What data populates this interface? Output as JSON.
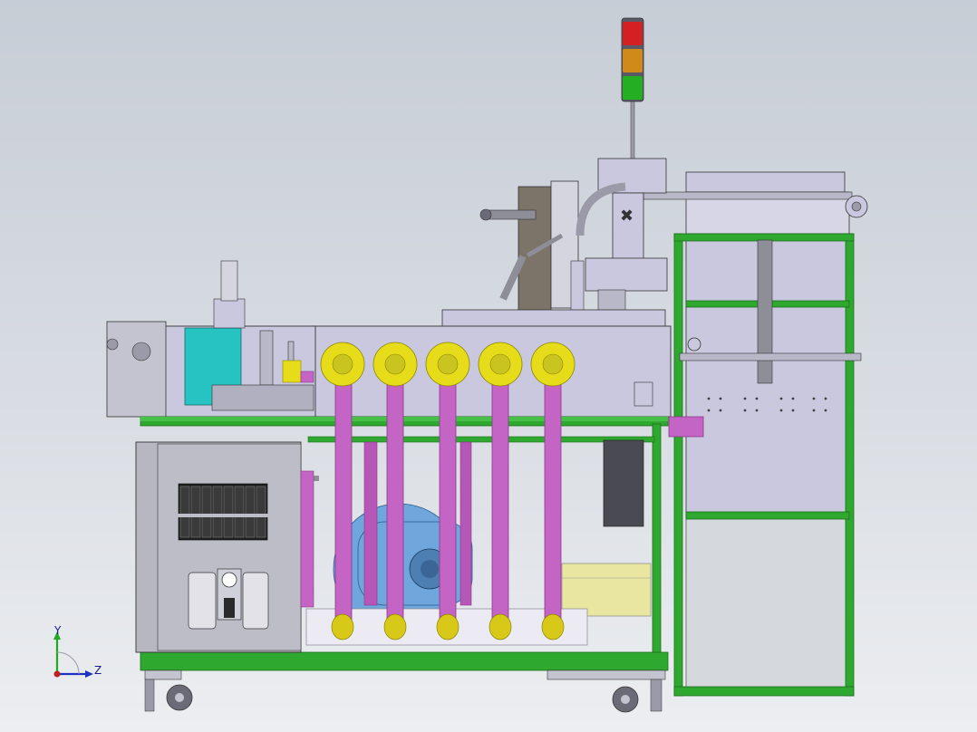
{
  "viewport": {
    "type": "cad-model-view",
    "background_top": "#c7cdd6",
    "background_bottom": "#eceef1"
  },
  "colors": {
    "frame_green": "#2fa82f",
    "frame_green_dark": "#1b6e1b",
    "pipe_magenta": "#c464c4",
    "pipe_magenta_dark": "#8a3a8a",
    "flange_yellow": "#e6dc1a",
    "body_lavender": "#c9c8df",
    "cyan_block": "#27c2c2",
    "blower_blue": "#6fa6dc",
    "panel_gray": "#bdbdc7",
    "tray_yellow": "#e8e6a0",
    "light_red": "#d42020",
    "light_amber": "#d08a1a",
    "light_green": "#22b022"
  },
  "stack_light": {
    "segments": [
      "red",
      "amber",
      "green"
    ]
  },
  "pipes": {
    "count": 5
  },
  "valve_bank": {
    "count": 8
  },
  "triad": {
    "y_label": "Y",
    "z_label": "Z"
  }
}
